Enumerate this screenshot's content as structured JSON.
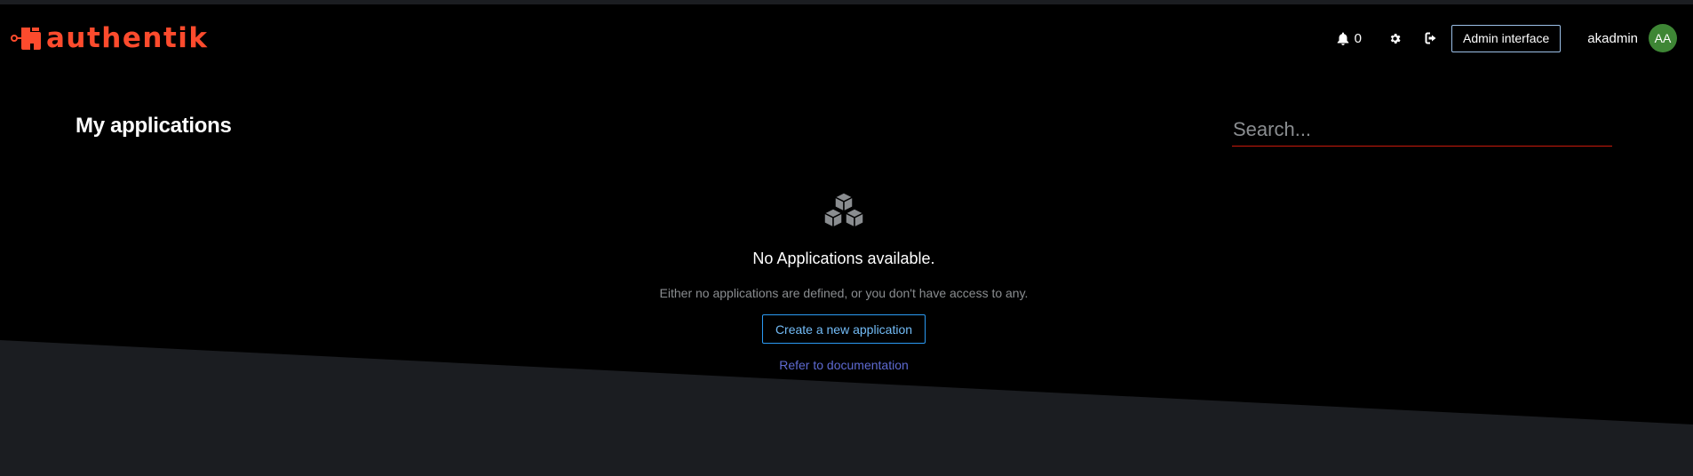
{
  "brand": {
    "name": "authentik",
    "color": "#fd4b2d"
  },
  "header": {
    "notifications": {
      "icon": "bell-icon",
      "count": "0"
    },
    "settings": {
      "icon": "gear-icon"
    },
    "logout": {
      "icon": "sign-out-icon"
    },
    "admin_button_label": "Admin interface",
    "username": "akadmin",
    "avatar_initials": "AA",
    "avatar_color": "#3e8635"
  },
  "main": {
    "title": "My applications",
    "search": {
      "placeholder": "Search...",
      "value": ""
    },
    "empty_state": {
      "icon": "cubes-icon",
      "title": "No Applications available.",
      "body": "Either no applications are defined, or you don't have access to any.",
      "create_button_label": "Create a new application",
      "docs_link_label": "Refer to documentation"
    }
  },
  "colors": {
    "background": "#000000",
    "lower_band": "#1b1d21",
    "accent_red": "#c9190b",
    "link_blue": "#73bcf7"
  }
}
